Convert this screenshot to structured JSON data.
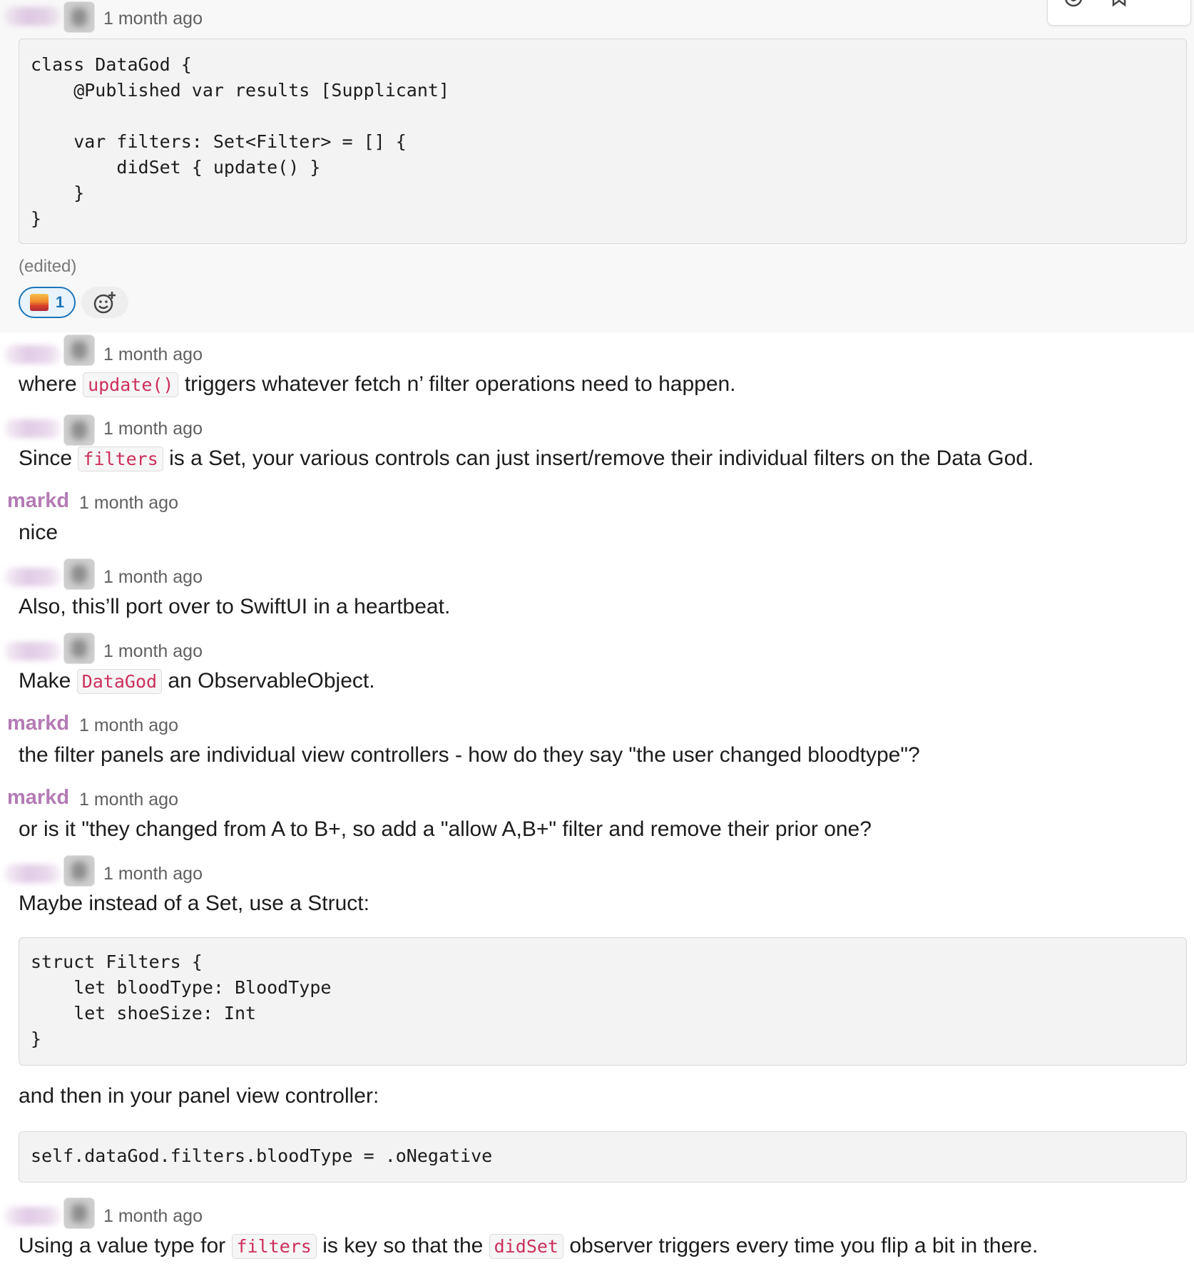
{
  "toolbar": {
    "icons": [
      "reaction-icon",
      "bookmark-icon",
      "more-icon"
    ]
  },
  "messages": [
    {
      "time": "1 month ago",
      "code": "class DataGod {\n    @Published var results [Supplicant]\n\n    var filters: Set<Filter> = [] {\n        didSet { update() }\n    }\n}",
      "edited": "(edited)",
      "reaction": {
        "emoji": "sunset-emoji",
        "count": "1"
      }
    },
    {
      "time": "1 month ago",
      "text_before": "where",
      "code1": "update()",
      "text_after": "triggers whatever fetch n’ filter operations need to happen."
    },
    {
      "time": "1 month ago",
      "text_before": "Since",
      "code1": "filters",
      "text_after": "is a Set, your various controls can just insert/remove their individual filters on the Data God."
    },
    {
      "user": "markd",
      "time": "1 month ago",
      "text": "nice"
    },
    {
      "time": "1 month ago",
      "text": "Also, this’ll port over to SwiftUI in a heartbeat."
    },
    {
      "time": "1 month ago",
      "text_before": "Make",
      "code1": "DataGod",
      "text_after": "an ObservableObject."
    },
    {
      "user": "markd",
      "time": "1 month ago",
      "text": "the filter panels are individual view controllers - how do they say \"the user changed bloodtype\"?"
    },
    {
      "user": "markd",
      "time": "1 month ago",
      "text": "or is it \"they changed from A to B+, so add a \"allow A,B+\" filter and remove their prior one?"
    },
    {
      "time": "1 month ago",
      "text": "Maybe instead of a Set, use a Struct:",
      "code": "struct Filters {\n    let bloodType: BloodType\n    let shoeSize: Int\n}",
      "text2": "and then in your panel view controller:",
      "code2": "self.dataGod.filters.bloodType = .oNegative"
    },
    {
      "time": "1 month ago",
      "text_before": "Using a value type for",
      "code1": "filters",
      "text_mid": "is key so that the",
      "code2": "didSet",
      "text_after": "observer triggers every time you flip a bit in there."
    }
  ]
}
